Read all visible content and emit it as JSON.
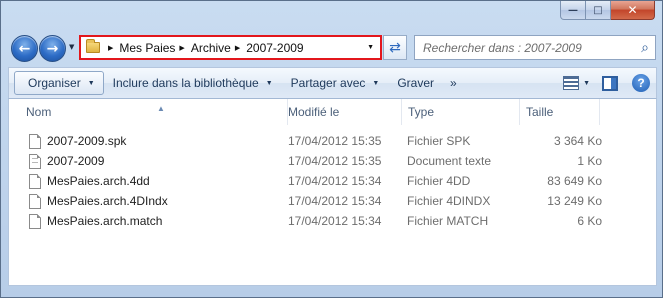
{
  "window": {
    "caption_buttons": {
      "minimize": "—",
      "maximize": "□",
      "close": "✕"
    }
  },
  "nav": {
    "back_icon": "back-arrow-icon",
    "forward_icon": "forward-arrow-icon",
    "breadcrumb": [
      "Mes Paies",
      "Archive",
      "2007-2009"
    ],
    "search_placeholder": "Rechercher dans : 2007-2009",
    "highlight_color": "#e3161c"
  },
  "toolbar": {
    "organiser": "Organiser",
    "include_library": "Inclure dans la bibliothèque",
    "share_with": "Partager avec",
    "burn": "Graver",
    "more": "»"
  },
  "columns": {
    "name": "Nom",
    "modified": "Modifié le",
    "type": "Type",
    "size": "Taille"
  },
  "files": [
    {
      "name": "2007-2009.spk",
      "modified": "17/04/2012 15:35",
      "type": "Fichier SPK",
      "size": "3 364 Ko",
      "icon": "generic-file-icon"
    },
    {
      "name": "2007-2009",
      "modified": "17/04/2012 15:35",
      "type": "Document texte",
      "size": "1 Ko",
      "icon": "text-file-icon"
    },
    {
      "name": "MesPaies.arch.4dd",
      "modified": "17/04/2012 15:34",
      "type": "Fichier 4DD",
      "size": "83 649 Ko",
      "icon": "generic-file-icon"
    },
    {
      "name": "MesPaies.arch.4DIndx",
      "modified": "17/04/2012 15:34",
      "type": "Fichier 4DINDX",
      "size": "13 249 Ko",
      "icon": "generic-file-icon"
    },
    {
      "name": "MesPaies.arch.match",
      "modified": "17/04/2012 15:34",
      "type": "Fichier MATCH",
      "size": "6 Ko",
      "icon": "generic-file-icon"
    }
  ]
}
